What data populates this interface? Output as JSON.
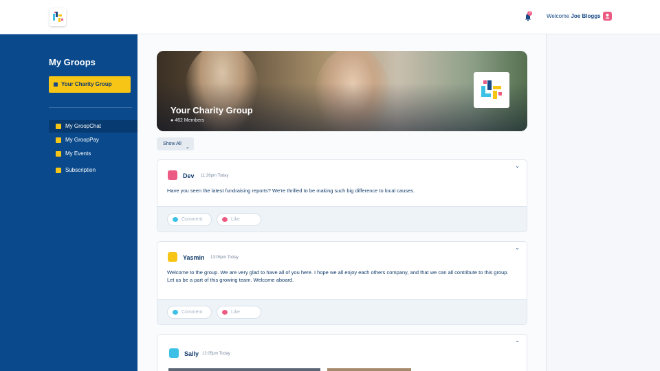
{
  "header": {
    "logo_alt": "app-logo",
    "notification_count": "2",
    "welcome_prefix": "Welcome",
    "user_name": "Joe Bloggs"
  },
  "sidebar": {
    "title": "My Groops",
    "group_button": "Your Charity Group",
    "items": [
      {
        "label": "My GroopChat",
        "icon": "chat-grid-icon",
        "active": true
      },
      {
        "label": "My GroopPay",
        "icon": "wallet-icon",
        "active": false
      },
      {
        "label": "My Events",
        "icon": "calendar-icon",
        "active": false
      },
      {
        "label": "Subscription",
        "icon": "subscription-icon",
        "active": false
      }
    ]
  },
  "hero": {
    "title": "Your Charity Group",
    "members": "462 Members"
  },
  "filter": {
    "label": "Show All"
  },
  "posts": [
    {
      "author": "Dev",
      "time": "11:26pm Today",
      "avatar_color": "#ec5b84",
      "body": "Have you seen the latest fundraising reports? We're thrilled to be making such big difference to local causes.",
      "comment_label": "Comment",
      "like_label": "Like"
    },
    {
      "author": "Yasmin",
      "time": "13:06pm Today",
      "avatar_color": "#f7c515",
      "body": "Welcome to the group. We are very glad to have all of you here. I hope we all enjoy each others company, and that we can all contribute to this group. Let us be a part of this growing team. Welcome aboard.",
      "comment_label": "Comment",
      "like_label": "Like"
    },
    {
      "author": "Sally",
      "time": "12:05pm Today",
      "avatar_color": "#3cc0e6"
    }
  ],
  "colors": {
    "sidebar_bg": "#0a4a8c",
    "accent_yellow": "#f7c515",
    "accent_pink": "#ec5b84",
    "accent_blue": "#3cc0e6"
  }
}
